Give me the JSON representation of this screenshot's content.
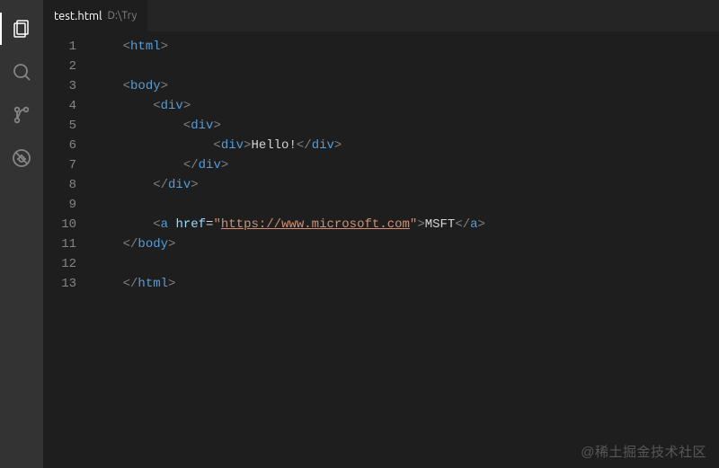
{
  "activityBar": {
    "items": [
      {
        "name": "explorer",
        "active": true
      },
      {
        "name": "search",
        "active": false
      },
      {
        "name": "source-control",
        "active": false
      },
      {
        "name": "debug",
        "active": false
      }
    ]
  },
  "tab": {
    "filename": "test.html",
    "path": "D:\\Try"
  },
  "code": {
    "lineCount": 13,
    "lines": [
      {
        "n": 1,
        "indent": 1,
        "parts": [
          {
            "t": "open",
            "name": "html"
          }
        ]
      },
      {
        "n": 2,
        "indent": 0,
        "parts": []
      },
      {
        "n": 3,
        "indent": 1,
        "parts": [
          {
            "t": "open",
            "name": "body"
          }
        ]
      },
      {
        "n": 4,
        "indent": 2,
        "parts": [
          {
            "t": "open",
            "name": "div"
          }
        ]
      },
      {
        "n": 5,
        "indent": 3,
        "parts": [
          {
            "t": "open",
            "name": "div"
          }
        ]
      },
      {
        "n": 6,
        "indent": 4,
        "parts": [
          {
            "t": "open",
            "name": "div"
          },
          {
            "t": "text",
            "value": "Hello!"
          },
          {
            "t": "close",
            "name": "div"
          }
        ]
      },
      {
        "n": 7,
        "indent": 3,
        "parts": [
          {
            "t": "close",
            "name": "div"
          }
        ]
      },
      {
        "n": 8,
        "indent": 2,
        "parts": [
          {
            "t": "close",
            "name": "div"
          }
        ]
      },
      {
        "n": 9,
        "indent": 0,
        "parts": []
      },
      {
        "n": 10,
        "indent": 2,
        "parts": [
          {
            "t": "open-attr",
            "name": "a",
            "attr": "href",
            "value": "https://www.microsoft.com"
          },
          {
            "t": "text",
            "value": "MSFT"
          },
          {
            "t": "close",
            "name": "a"
          }
        ]
      },
      {
        "n": 11,
        "indent": 1,
        "parts": [
          {
            "t": "close",
            "name": "body"
          }
        ]
      },
      {
        "n": 12,
        "indent": 0,
        "parts": []
      },
      {
        "n": 13,
        "indent": 1,
        "parts": [
          {
            "t": "close",
            "name": "html"
          }
        ]
      }
    ]
  },
  "watermark": "@稀土掘金技术社区"
}
